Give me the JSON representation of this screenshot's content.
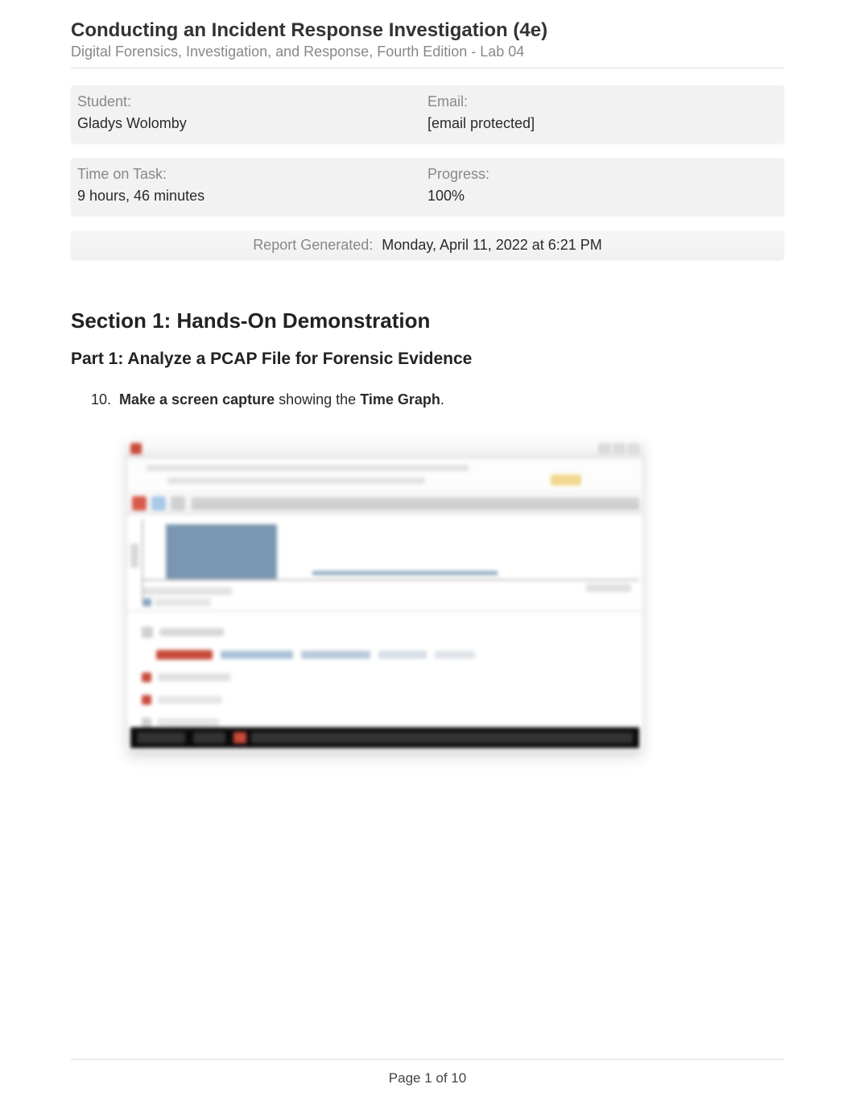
{
  "header": {
    "title": "Conducting an Incident Response Investigation (4e)",
    "subtitle": "Digital Forensics, Investigation, and Response, Fourth Edition - Lab 04"
  },
  "info": {
    "student_label": "Student:",
    "student_value": "Gladys Wolomby",
    "email_label": "Email:",
    "email_value": "[email protected]",
    "time_label": "Time on Task:",
    "time_value": "9 hours, 46 minutes",
    "progress_label": "Progress:",
    "progress_value": "100%"
  },
  "report": {
    "label": "Report Generated:",
    "value": "Monday, April 11, 2022 at 6:21 PM"
  },
  "section": {
    "title": "Section 1: Hands-On Demonstration",
    "part_title": "Part 1: Analyze a PCAP File for Forensic Evidence"
  },
  "instruction": {
    "number": "10.",
    "bold1": "Make a screen capture",
    "mid": " showing the ",
    "bold2": "Time Graph",
    "end": "."
  },
  "footer": {
    "page": "Page 1 of 10"
  }
}
